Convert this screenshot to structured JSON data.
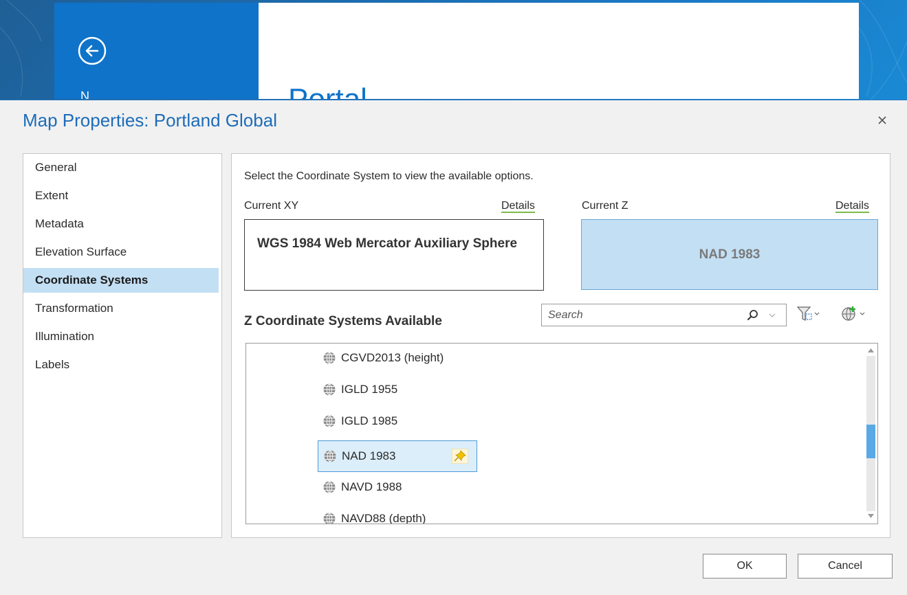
{
  "background": {
    "sidebar_peek_text": "N",
    "title_peek_text": "Portal"
  },
  "dialog": {
    "title": "Map Properties: Portland Global",
    "close_glyph": "×"
  },
  "nav": {
    "items": [
      {
        "label": "General"
      },
      {
        "label": "Extent"
      },
      {
        "label": "Metadata"
      },
      {
        "label": "Elevation Surface"
      },
      {
        "label": "Coordinate Systems"
      },
      {
        "label": "Transformation"
      },
      {
        "label": "Illumination"
      },
      {
        "label": "Labels"
      }
    ],
    "selected": "Coordinate Systems"
  },
  "content": {
    "instructions": "Select the Coordinate System to view the available options.",
    "current_xy_label": "Current XY",
    "current_z_label": "Current Z",
    "details_label": "Details",
    "current_xy_value": "WGS 1984 Web Mercator Auxiliary Sphere",
    "current_z_value": "NAD 1983",
    "z_list_heading": "Z Coordinate Systems Available",
    "search_placeholder": "Search"
  },
  "z_systems": [
    {
      "label": "CGVD2013 (height)"
    },
    {
      "label": "IGLD 1955"
    },
    {
      "label": "IGLD 1985"
    },
    {
      "label": "NAD 1983"
    },
    {
      "label": "NAVD 1988"
    },
    {
      "label": "NAVD88 (depth)"
    }
  ],
  "selected_z_system": "NAD 1983",
  "buttons": {
    "ok": "OK",
    "cancel": "Cancel"
  },
  "colors": {
    "accent": "#1d6cb8",
    "selection": "#c3dff4",
    "details_underline": "#7dba4c",
    "scroll_thumb": "#5aa9e6"
  }
}
